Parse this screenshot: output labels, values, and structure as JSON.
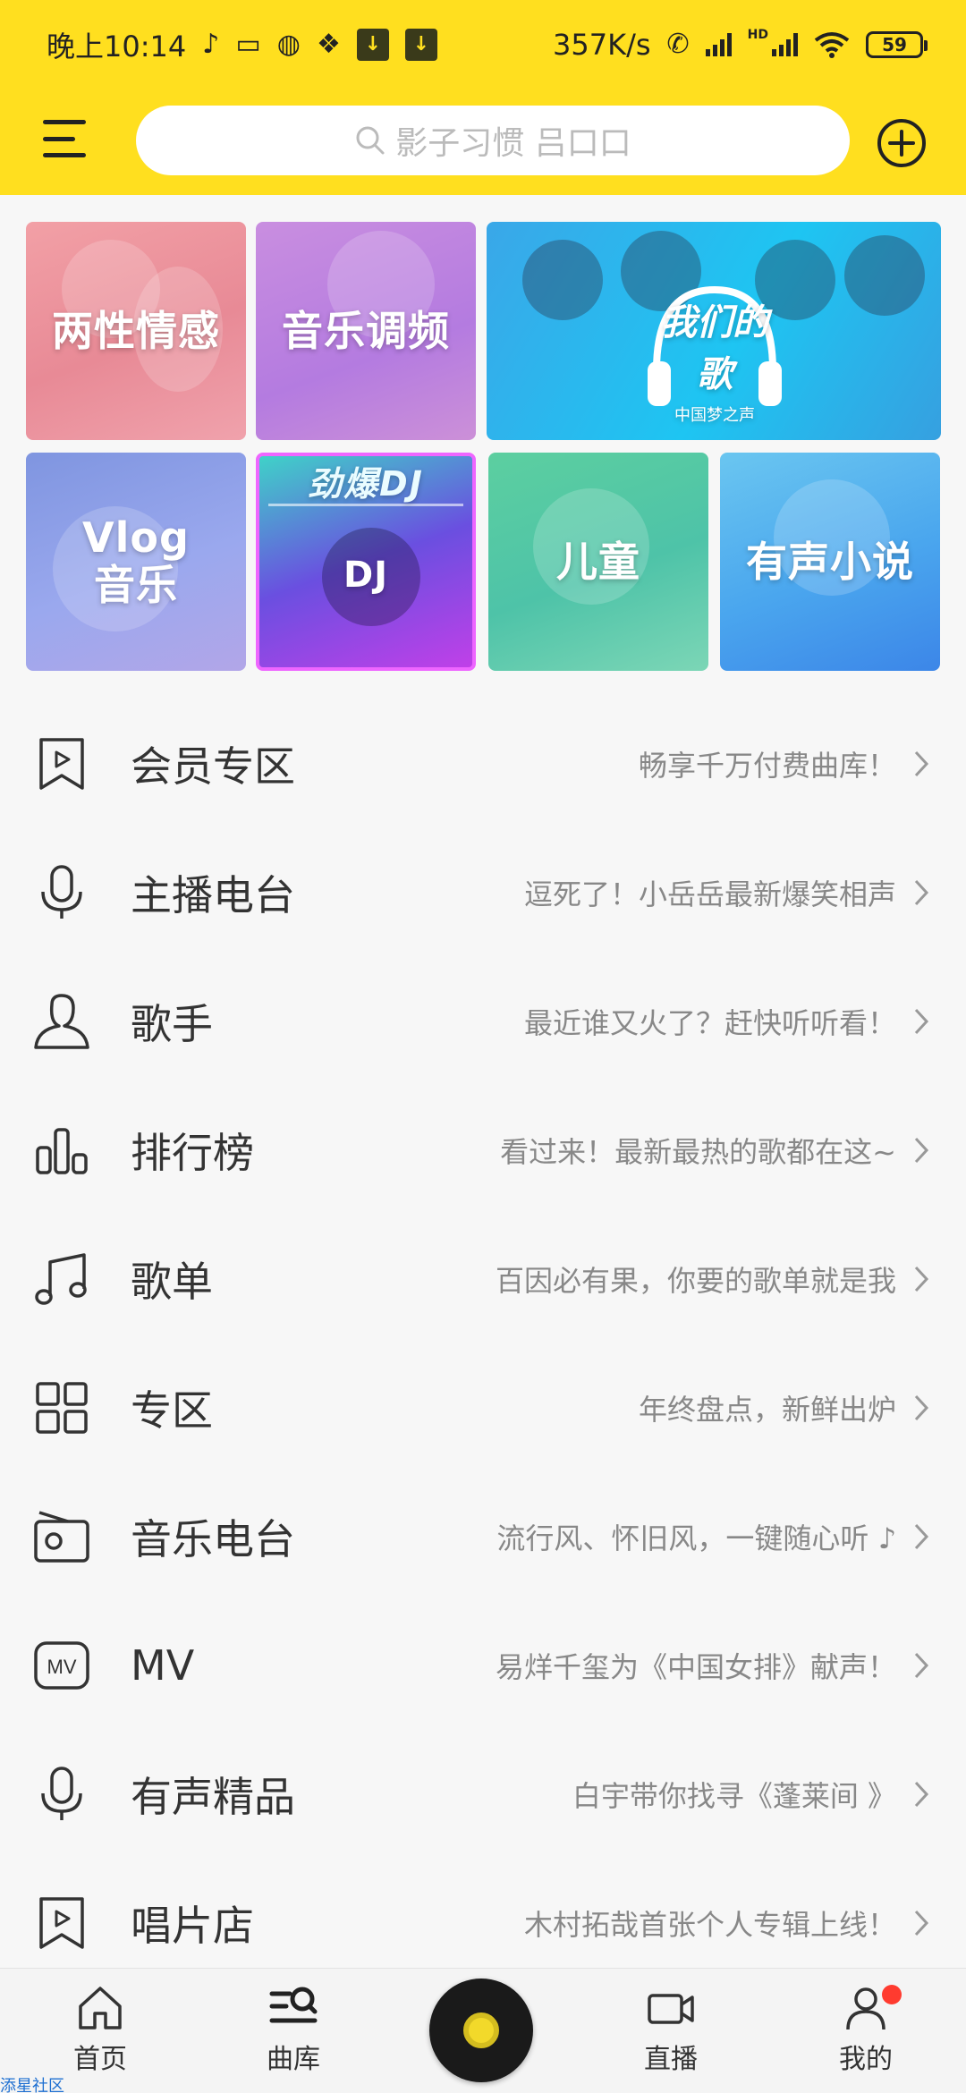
{
  "status_bar": {
    "time": "晚上10:14",
    "network_speed": "357K/s",
    "hd_label": "HD",
    "battery": "59"
  },
  "header": {
    "search_placeholder": "影子习惯 吕口口"
  },
  "banners": [
    {
      "label": "两性情感"
    },
    {
      "label": "音乐调频"
    },
    {
      "label": "我们的歌",
      "sub": "中国梦之声"
    },
    {
      "label_line1": "Vlog",
      "label_line2": "音乐"
    },
    {
      "label": "DJ",
      "top_text": "劲爆DJ"
    },
    {
      "label": "儿童"
    },
    {
      "label": "有声小说"
    }
  ],
  "list": [
    {
      "icon": "bookmark-play-icon",
      "title": "会员专区",
      "subtitle": "畅享千万付费曲库！"
    },
    {
      "icon": "microphone-icon",
      "title": "主播电台",
      "subtitle": "逗死了！小岳岳最新爆笑相声"
    },
    {
      "icon": "person-icon",
      "title": "歌手",
      "subtitle": "最近谁又火了？赶快听听看！"
    },
    {
      "icon": "bar-chart-icon",
      "title": "排行榜",
      "subtitle": "看过来！最新最热的歌都在这~"
    },
    {
      "icon": "music-note-icon",
      "title": "歌单",
      "subtitle": "百因必有果，你要的歌单就是我"
    },
    {
      "icon": "grid-icon",
      "title": "专区",
      "subtitle": "年终盘点，新鲜出炉"
    },
    {
      "icon": "radio-icon",
      "title": "音乐电台",
      "subtitle": "流行风、怀旧风，一键随心听 ♪"
    },
    {
      "icon": "mv-icon",
      "title": "MV",
      "subtitle": "易烊千玺为《中国女排》献声！"
    },
    {
      "icon": "microphone-icon",
      "title": "有声精品",
      "subtitle": "白宇带你找寻《蓬莱间 》"
    },
    {
      "icon": "bookmark-play-icon",
      "title": "唱片店",
      "subtitle": "木村拓哉首张个人专辑上线！"
    }
  ],
  "bottom_nav": {
    "home": "首页",
    "library": "曲库",
    "live": "直播",
    "mine": "我的"
  },
  "watermark": "添星社区",
  "colors": {
    "header_bg": "#ffdf1f",
    "badge": "#ff3b2f"
  }
}
